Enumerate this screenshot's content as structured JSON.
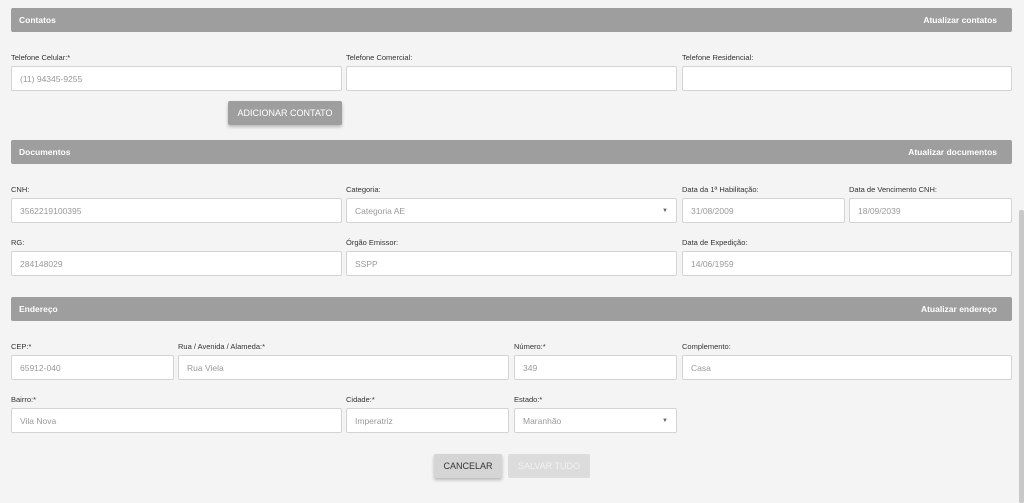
{
  "contatos": {
    "title": "Contatos",
    "action": "Atualizar contatos",
    "celular_label": "Telefone Celular:*",
    "celular_value": "(11) 94345-9255",
    "comercial_label": "Telefone Comercial:",
    "comercial_value": "",
    "residencial_label": "Telefone Residencial:",
    "residencial_value": "",
    "add_button": "Adicionar contato"
  },
  "documentos": {
    "title": "Documentos",
    "action": "Atualizar documentos",
    "cnh_label": "CNH:",
    "cnh_value": "3562219100395",
    "categoria_label": "Categoria:",
    "categoria_value": "Categoria AE",
    "habilitacao_label": "Data da 1ª Habilitação:",
    "habilitacao_value": "31/08/2009",
    "vencimento_label": "Data de Vencimento CNH:",
    "vencimento_value": "18/09/2039",
    "rg_label": "RG:",
    "rg_value": "284148029",
    "orgao_label": "Órgão Emissor:",
    "orgao_value": "SSPP",
    "expedicao_label": "Data de Expedição:",
    "expedicao_value": "14/06/1959"
  },
  "endereco": {
    "title": "Endereço",
    "action": "Atualizar endereço",
    "cep_label": "CEP:*",
    "cep_value": "65912-040",
    "rua_label": "Rua / Avenida / Alameda:*",
    "rua_value": "Rua Viela",
    "numero_label": "Número:*",
    "numero_value": "349",
    "complemento_label": "Complemento:",
    "complemento_value": "Casa",
    "bairro_label": "Bairro:*",
    "bairro_value": "Vila Nova",
    "cidade_label": "Cidade:*",
    "cidade_value": "Imperatriz",
    "estado_label": "Estado:*",
    "estado_value": "Maranhão"
  },
  "footer": {
    "cancel": "Cancelar",
    "save": "Salvar tudo"
  },
  "icons": {
    "select_caret": "chevron-down-icon"
  }
}
